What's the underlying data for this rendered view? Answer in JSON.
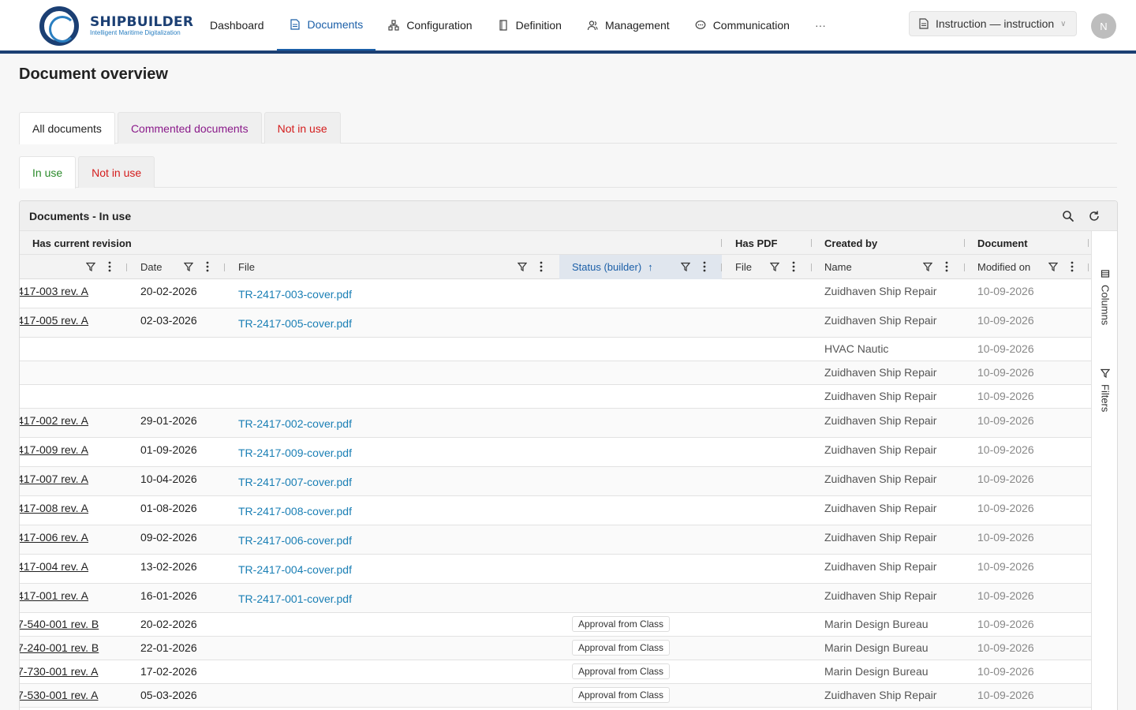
{
  "brand": {
    "name": "SHIPBUILDER",
    "tagline": "Intelligent Maritime Digitalization"
  },
  "nav": {
    "items": [
      {
        "label": "Dashboard",
        "icon": ""
      },
      {
        "label": "Documents",
        "icon": "document-icon"
      },
      {
        "label": "Configuration",
        "icon": "hierarchy-icon"
      },
      {
        "label": "Definition",
        "icon": "book-icon"
      },
      {
        "label": "Management",
        "icon": "users-icon"
      },
      {
        "label": "Communication",
        "icon": "chat-icon"
      }
    ],
    "more": "···",
    "active": "Documents"
  },
  "instruction_select": {
    "value": "Instruction — instruction"
  },
  "user": {
    "initial": "N"
  },
  "page": {
    "title": "Document overview"
  },
  "tabs_main": [
    {
      "label": "All documents",
      "color": "#222222"
    },
    {
      "label": "Commented documents",
      "color": "#8a1a8a"
    },
    {
      "label": "Not in use",
      "color": "#d41c1c"
    }
  ],
  "tabs_sub": [
    {
      "label": "In use",
      "color": "#2a8a2a"
    },
    {
      "label": "Not in use",
      "color": "#d41c1c"
    }
  ],
  "panel": {
    "title": "Documents - In use",
    "groups": [
      "Has current revision",
      "Has PDF",
      "Created by",
      "Document"
    ],
    "columns": [
      "Date",
      "File",
      "Status (builder)",
      "File",
      "Name",
      "Modified on"
    ],
    "sort": {
      "column": "Status (builder)",
      "direction": "ascending"
    },
    "sidebar": {
      "columns": "Columns",
      "filters": "Filters"
    }
  },
  "rows": [
    {
      "doc": "417-003 rev. A",
      "date": "20-02-2026",
      "file": "TR-2417-003-cover.pdf",
      "status": "",
      "pdf": "",
      "name": "Zuidhaven Ship Repair",
      "modified": "10-09-2026"
    },
    {
      "doc": "417-005 rev. A",
      "date": "02-03-2026",
      "file": "TR-2417-005-cover.pdf",
      "status": "",
      "pdf": "",
      "name": "Zuidhaven Ship Repair",
      "modified": "10-09-2026"
    },
    {
      "doc": "",
      "date": "",
      "file": "",
      "status": "",
      "pdf": "",
      "name": "HVAC Nautic",
      "modified": "10-09-2026"
    },
    {
      "doc": "",
      "date": "",
      "file": "",
      "status": "",
      "pdf": "",
      "name": "Zuidhaven Ship Repair",
      "modified": "10-09-2026"
    },
    {
      "doc": "",
      "date": "",
      "file": "",
      "status": "",
      "pdf": "",
      "name": "Zuidhaven Ship Repair",
      "modified": "10-09-2026"
    },
    {
      "doc": "417-002 rev. A",
      "date": "29-01-2026",
      "file": "TR-2417-002-cover.pdf",
      "status": "",
      "pdf": "",
      "name": "Zuidhaven Ship Repair",
      "modified": "10-09-2026"
    },
    {
      "doc": "417-009 rev. A",
      "date": "01-09-2026",
      "file": "TR-2417-009-cover.pdf",
      "status": "",
      "pdf": "",
      "name": "Zuidhaven Ship Repair",
      "modified": "10-09-2026"
    },
    {
      "doc": "417-007 rev. A",
      "date": "10-04-2026",
      "file": "TR-2417-007-cover.pdf",
      "status": "",
      "pdf": "",
      "name": "Zuidhaven Ship Repair",
      "modified": "10-09-2026"
    },
    {
      "doc": "417-008 rev. A",
      "date": "01-08-2026",
      "file": "TR-2417-008-cover.pdf",
      "status": "",
      "pdf": "",
      "name": "Zuidhaven Ship Repair",
      "modified": "10-09-2026"
    },
    {
      "doc": "417-006 rev. A",
      "date": "09-02-2026",
      "file": "TR-2417-006-cover.pdf",
      "status": "",
      "pdf": "",
      "name": "Zuidhaven Ship Repair",
      "modified": "10-09-2026"
    },
    {
      "doc": "417-004 rev. A",
      "date": "13-02-2026",
      "file": "TR-2417-004-cover.pdf",
      "status": "",
      "pdf": "",
      "name": "Zuidhaven Ship Repair",
      "modified": "10-09-2026"
    },
    {
      "doc": "417-001 rev. A",
      "date": "16-01-2026",
      "file": "TR-2417-001-cover.pdf",
      "status": "",
      "pdf": "",
      "name": "Zuidhaven Ship Repair",
      "modified": "10-09-2026"
    },
    {
      "doc": "7-540-001 rev. B",
      "date": "20-02-2026",
      "file": "",
      "status": "Approval from Class",
      "pdf": "",
      "name": "Marin Design Bureau",
      "modified": "10-09-2026"
    },
    {
      "doc": "7-240-001 rev. B",
      "date": "22-01-2026",
      "file": "",
      "status": "Approval from Class",
      "pdf": "",
      "name": "Marin Design Bureau",
      "modified": "10-09-2026"
    },
    {
      "doc": "7-730-001 rev. A",
      "date": "17-02-2026",
      "file": "",
      "status": "Approval from Class",
      "pdf": "",
      "name": "Marin Design Bureau",
      "modified": "10-09-2026"
    },
    {
      "doc": "7-530-001 rev. A",
      "date": "05-03-2026",
      "file": "",
      "status": "Approval from Class",
      "pdf": "",
      "name": "Zuidhaven Ship Repair",
      "modified": "10-09-2026"
    }
  ]
}
